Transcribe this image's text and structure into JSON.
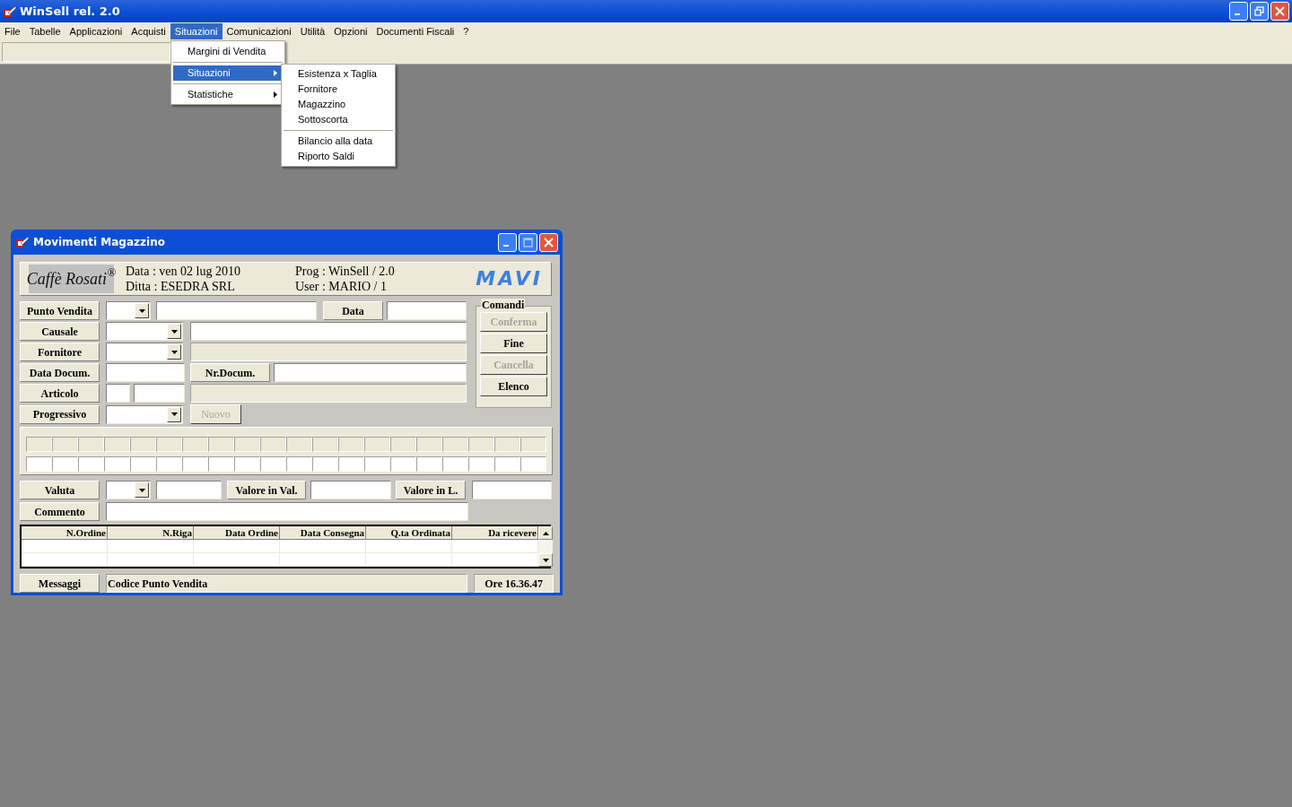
{
  "window": {
    "title": "WinSell rel. 2.0"
  },
  "menu_bar": [
    {
      "label": "File",
      "selected": false
    },
    {
      "label": "Tabelle",
      "selected": false
    },
    {
      "label": "Applicazioni",
      "selected": false
    },
    {
      "label": "Acquisti",
      "selected": false
    },
    {
      "label": "Situazioni",
      "selected": true
    },
    {
      "label": "Comunicazioni",
      "selected": false
    },
    {
      "label": "Utilità",
      "selected": false
    },
    {
      "label": "Opzioni",
      "selected": false
    },
    {
      "label": "Documenti Fiscali",
      "selected": false
    },
    {
      "label": "?",
      "selected": false
    }
  ],
  "dropdown_menu": [
    {
      "kind": "item",
      "label": "Margini di Vendita",
      "selected": false,
      "submenu": false
    },
    {
      "kind": "separator"
    },
    {
      "kind": "item",
      "label": "Situazioni",
      "selected": true,
      "submenu": true
    },
    {
      "kind": "separator"
    },
    {
      "kind": "item",
      "label": "Statistiche",
      "selected": false,
      "submenu": true
    }
  ],
  "submenu": [
    {
      "kind": "item",
      "label": "Esistenza x Taglia"
    },
    {
      "kind": "item",
      "label": "Fornitore"
    },
    {
      "kind": "item",
      "label": "Magazzino"
    },
    {
      "kind": "item",
      "label": "Sottoscorta"
    },
    {
      "kind": "separator"
    },
    {
      "kind": "item",
      "label": "Bilancio alla data"
    },
    {
      "kind": "item",
      "label": "Riporto Saldi"
    }
  ],
  "child_window": {
    "title": "Movimenti Magazzino",
    "header": {
      "logo": "Caffè Rosati$^{®}$",
      "lines_left": [
        "Data : ven 02 lug 2010",
        "Ditta : ESEDRA SRL"
      ],
      "lines_right": [
        "Prog : WinSell / 2.0",
        "User : MARIO / 1"
      ],
      "brand": "MAVI"
    },
    "labels": {
      "punto_vendita": "Punto Vendita",
      "data": "Data",
      "causale": "Causale",
      "fornitore": "Fornitore",
      "data_docum": "Data Docum.",
      "nr_docum": "Nr.Docum.",
      "articolo": "Articolo",
      "progressivo": "Progressivo",
      "valuta": "Valuta",
      "valore_in_val": "Valore in Val.",
      "valore_in_l": "Valore in L.",
      "commento": "Commento",
      "messaggi": "Messaggi"
    },
    "nuovo_button": {
      "label": "Nuovo",
      "disabled": true
    },
    "commands": {
      "title": "Comandi",
      "buttons": [
        {
          "label": "Conferma",
          "disabled": true
        },
        {
          "label": "Fine",
          "disabled": false
        },
        {
          "label": "Cancella",
          "disabled": true
        },
        {
          "label": "Elenco",
          "disabled": false
        }
      ]
    },
    "table": {
      "columns": [
        "N.Ordine",
        "N.Riga",
        "Data Ordine",
        "Data Consegna",
        "Q.ta Ordinata",
        "Da ricevere"
      ]
    },
    "status": {
      "message": "Codice Punto Vendita",
      "time": "Ore 16.36.47"
    }
  }
}
